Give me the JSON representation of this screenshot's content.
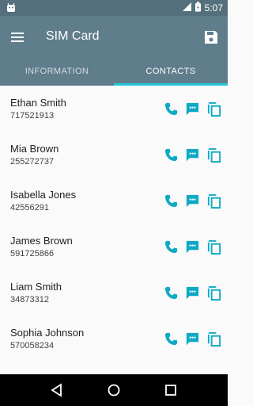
{
  "status_bar": {
    "time": "5:07"
  },
  "app_bar": {
    "title": "SIM Card"
  },
  "tabs": [
    {
      "label": "INFORMATION"
    },
    {
      "label": "CONTACTS"
    }
  ],
  "contacts": [
    {
      "name": "Ethan Smith",
      "phone": "717521913"
    },
    {
      "name": "Mia Brown",
      "phone": "255272737"
    },
    {
      "name": "Isabella Jones",
      "phone": "42556291"
    },
    {
      "name": "James Brown",
      "phone": "591725866"
    },
    {
      "name": "Liam Smith",
      "phone": "34873312"
    },
    {
      "name": "Sophia Johnson",
      "phone": "570058234"
    }
  ],
  "colors": {
    "app_bar": "#607d8b",
    "accent": "#26c6da",
    "action_icons": "#0fa9c4"
  },
  "icons": {
    "row_actions": [
      "phone-icon",
      "message-icon",
      "copy-icon"
    ]
  }
}
